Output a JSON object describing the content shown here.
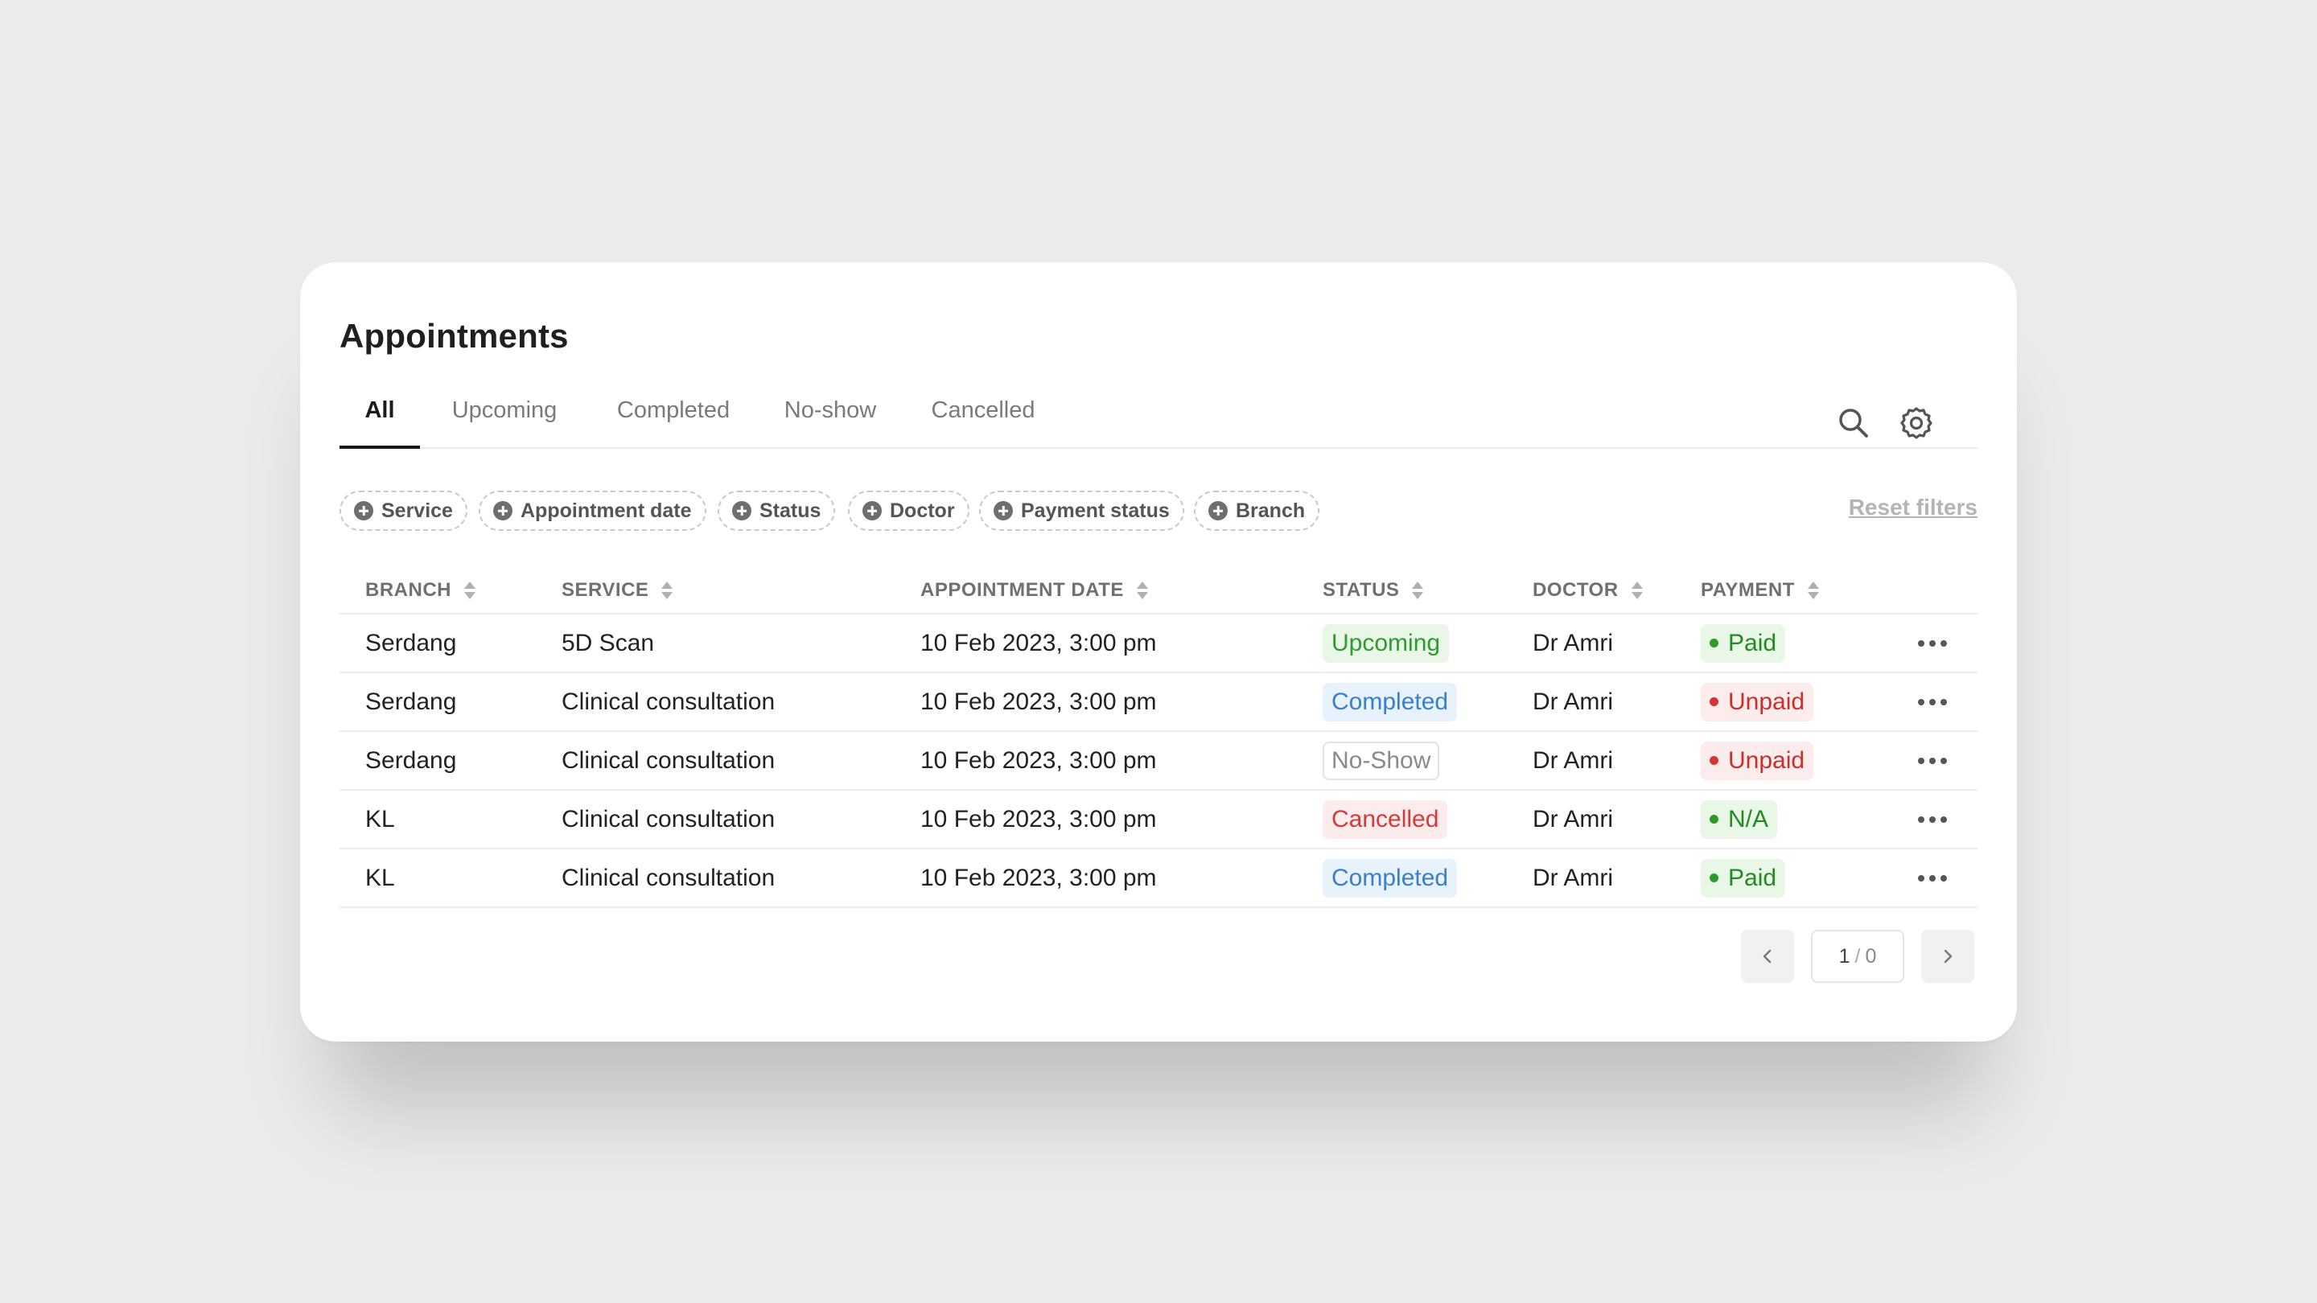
{
  "title": "Appointments",
  "tabs": [
    {
      "label": "All",
      "active": true
    },
    {
      "label": "Upcoming"
    },
    {
      "label": "Completed"
    },
    {
      "label": "No-show"
    },
    {
      "label": "Cancelled"
    }
  ],
  "toolbar": {
    "search_icon": "search-icon",
    "settings_icon": "gear-icon"
  },
  "filters": [
    "Service",
    "Appointment date",
    "Status",
    "Doctor",
    "Payment status",
    "Branch"
  ],
  "reset_label": "Reset filters",
  "columns": [
    "BRANCH",
    "SERVICE",
    "APPOINTMENT DATE",
    "STATUS",
    "DOCTOR",
    "PAYMENT"
  ],
  "rows": [
    {
      "branch": "Serdang",
      "service": "5D Scan",
      "date": "10 Feb 2023, 3:00 pm",
      "status": "Upcoming",
      "doctor": "Dr Amri",
      "payment": "Paid"
    },
    {
      "branch": "Serdang",
      "service": "Clinical consultation",
      "date": "10 Feb 2023, 3:00 pm",
      "status": "Completed",
      "doctor": "Dr Amri",
      "payment": "Unpaid"
    },
    {
      "branch": "Serdang",
      "service": "Clinical consultation",
      "date": "10 Feb 2023, 3:00 pm",
      "status": "No-Show",
      "doctor": "Dr Amri",
      "payment": "Unpaid"
    },
    {
      "branch": "KL",
      "service": "Clinical consultation",
      "date": "10 Feb 2023, 3:00 pm",
      "status": "Cancelled",
      "doctor": "Dr Amri",
      "payment": "N/A"
    },
    {
      "branch": "KL",
      "service": "Clinical consultation",
      "date": "10 Feb 2023, 3:00 pm",
      "status": "Completed",
      "doctor": "Dr Amri",
      "payment": "Paid"
    }
  ],
  "pagination": {
    "current": "1",
    "separator": "/",
    "total": "0"
  },
  "colors": {
    "upcoming": "#2f9a2f",
    "completed": "#3a7fc7",
    "cancelled": "#d33b3b",
    "paid": "#238a23",
    "unpaid": "#c92f2f"
  }
}
